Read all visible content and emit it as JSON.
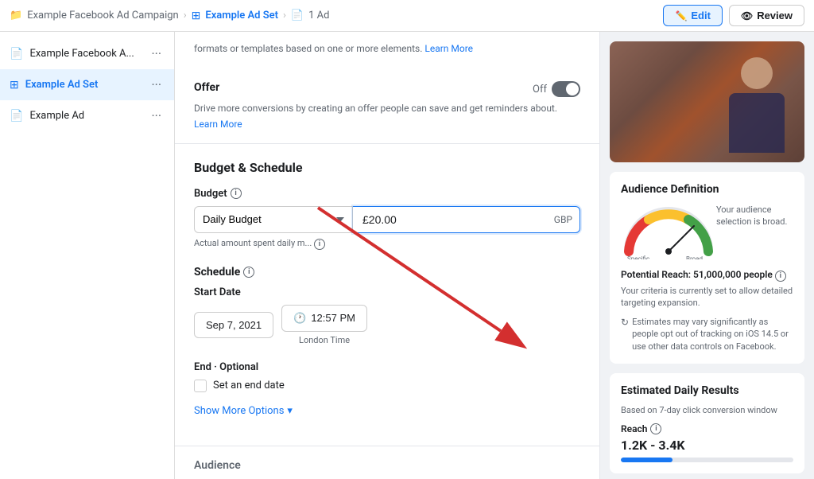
{
  "topNav": {
    "campaign_icon": "📁",
    "campaign_text": "Example Facebook Ad Campaign",
    "sep1": ">",
    "adset_icon": "⊞",
    "adset_text": "Example Ad Set",
    "sep2": ">",
    "ad_icon": "📄",
    "ad_text": "1 Ad",
    "edit_label": "Edit",
    "review_label": "Review"
  },
  "sidebar": {
    "items": [
      {
        "id": "example-facebook-a",
        "label": "Example Facebook A...",
        "icon": "📄",
        "icon_color": "gray"
      },
      {
        "id": "example-ad-set",
        "label": "Example Ad Set",
        "icon": "⊞",
        "icon_color": "blue",
        "active": true
      },
      {
        "id": "example-ad",
        "label": "Example Ad",
        "icon": "📄",
        "icon_color": "gray"
      }
    ]
  },
  "mainContent": {
    "intro_text": "formats or templates based on one or more elements.",
    "learn_more_text": "Learn More",
    "offer": {
      "title": "Offer",
      "toggle_state": "Off",
      "description": "Drive more conversions by creating an offer people can save and get reminders about.",
      "learn_more": "Learn More"
    },
    "budgetSchedule": {
      "section_title": "Budget & Schedule",
      "budget_label": "Budget",
      "budget_type": "Daily Budget",
      "budget_amount": "£20.00",
      "currency": "GBP",
      "budget_hint": "Actual amount spent daily m...",
      "schedule_label": "Schedule",
      "start_date_label": "Start Date",
      "start_date": "Sep 7, 2021",
      "start_time": "12:57 PM",
      "time_zone": "London Time",
      "end_label": "End · Optional",
      "end_checkbox_label": "Set an end date",
      "show_more": "Show More Options"
    },
    "audience_label": "Audience"
  },
  "rightPanel": {
    "video_placeholder": "Person speaking",
    "audienceDef": {
      "title": "Audience Definition",
      "reach_label": "Potential Reach: 51,000,000 people",
      "reach_note": "Your criteria is currently set to allow detailed targeting expansion.",
      "estimate_note": "Estimates may vary significantly as people opt out of tracking on iOS 14.5 or use other data controls on Facebook.",
      "audience_desc": "Your audience selection is broad."
    },
    "dailyResults": {
      "title": "Estimated Daily Results",
      "subtitle": "Based on 7-day click conversion window",
      "reach_label": "Reach",
      "reach_value": "1.2K - 3.4K"
    }
  }
}
